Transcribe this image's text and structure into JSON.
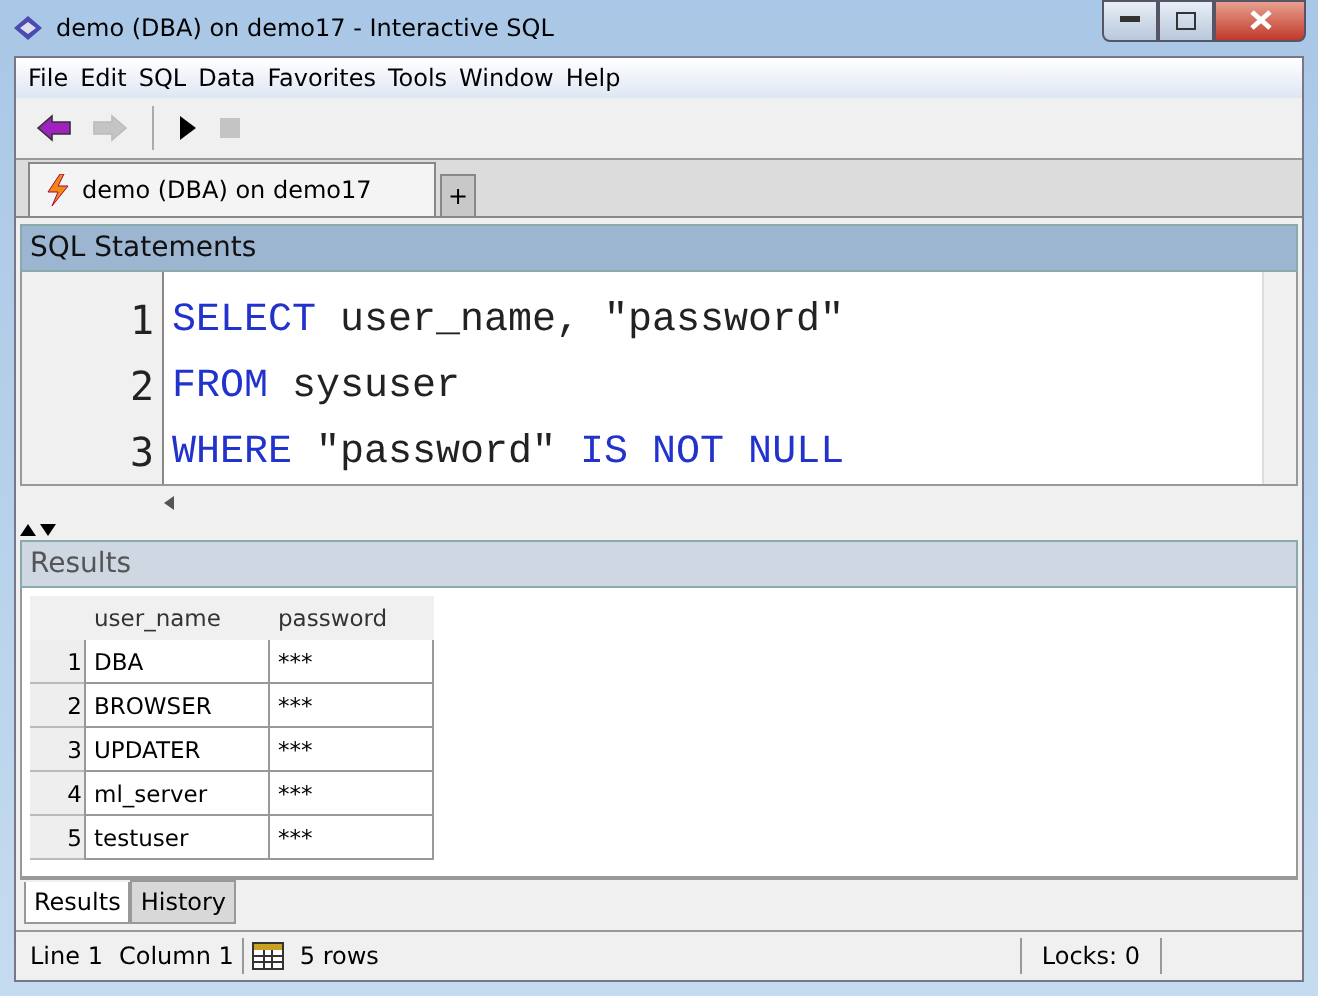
{
  "window": {
    "title": "demo (DBA) on demo17 - Interactive SQL"
  },
  "menu": [
    "File",
    "Edit",
    "SQL",
    "Data",
    "Favorites",
    "Tools",
    "Window",
    "Help"
  ],
  "toolbar": [
    {
      "kind": "back",
      "disabled": false
    },
    {
      "kind": "forward",
      "disabled": true
    },
    {
      "kind": "run",
      "disabled": false
    },
    {
      "kind": "stop",
      "disabled": true
    }
  ],
  "connection_tabs": [
    {
      "label": "demo (DBA) on demo17",
      "selected": true
    },
    {
      "label": "+",
      "selected": false
    }
  ],
  "sql_panel": {
    "title": "SQL Statements",
    "lines": [
      {
        "number": "1",
        "tokens": [
          {
            "kind": "keyword",
            "text": "SELECT"
          },
          {
            "kind": "text",
            "text": " user_name, \"password\""
          }
        ]
      },
      {
        "number": "2",
        "tokens": [
          {
            "kind": "keyword",
            "text": "FROM"
          },
          {
            "kind": "text",
            "text": " sysuser"
          }
        ]
      },
      {
        "number": "3",
        "tokens": [
          {
            "kind": "keyword",
            "text": "WHERE"
          },
          {
            "kind": "text",
            "text": " \"password\" "
          },
          {
            "kind": "keyword",
            "text": "IS NOT NULL"
          }
        ]
      }
    ]
  },
  "results_panel": {
    "title": "Results",
    "columns": [
      "user_name",
      "password"
    ],
    "rows": [
      {
        "number": "1",
        "cells": [
          "DBA",
          "***"
        ]
      },
      {
        "number": "2",
        "cells": [
          "BROWSER",
          "***"
        ]
      },
      {
        "number": "3",
        "cells": [
          "UPDATER",
          "***"
        ]
      },
      {
        "number": "4",
        "cells": [
          "ml_server",
          "***"
        ]
      },
      {
        "number": "5",
        "cells": [
          "testuser",
          "***"
        ]
      }
    ],
    "tabs": [
      {
        "label": "Results",
        "selected": true
      },
      {
        "label": "History",
        "selected": false
      }
    ]
  },
  "status_bar": {
    "line": "Line 1",
    "column": "Column 1",
    "rows": "5 rows",
    "locks": "Locks: 0"
  }
}
